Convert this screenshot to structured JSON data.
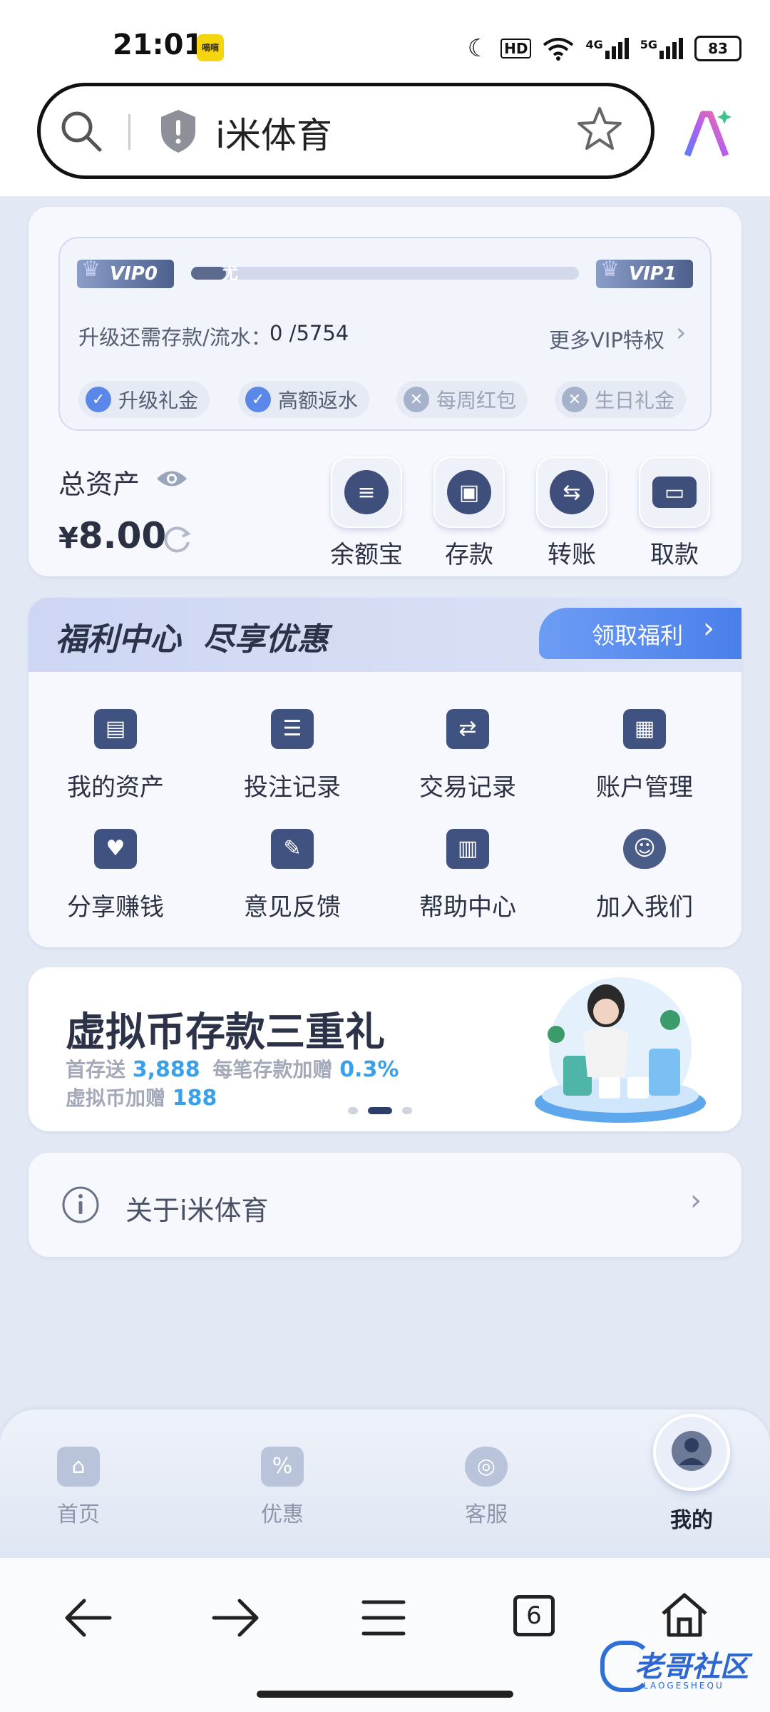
{
  "status_bar": {
    "time": "21:01",
    "app_badge": "嘀嘀",
    "network_hd": "HD",
    "net_4g": "4G",
    "net_5g": "5G",
    "battery": "83"
  },
  "browser": {
    "site_title": "i米体育"
  },
  "vip": {
    "current_level": "VIP0",
    "next_level": "VIP1",
    "progress_fraction": 0.05,
    "progress_marker": "尤",
    "upgrade_label": "升级还需存款/流水：",
    "upgrade_value": "0 /5754",
    "more_link": "更多VIP特权",
    "perks": [
      {
        "label": "升级礼金",
        "enabled": true
      },
      {
        "label": "高额返水",
        "enabled": true
      },
      {
        "label": "每周红包",
        "enabled": false
      },
      {
        "label": "生日礼金",
        "enabled": false
      }
    ]
  },
  "assets": {
    "label": "总资产",
    "currency": "¥",
    "amount": "8.00"
  },
  "quick_actions": [
    {
      "label": "余额宝",
      "icon": "coins-icon"
    },
    {
      "label": "存款",
      "icon": "deposit-icon"
    },
    {
      "label": "转账",
      "icon": "transfer-icon"
    },
    {
      "label": "取款",
      "icon": "card-icon"
    }
  ],
  "welfare": {
    "title": "福利中心  尽享优惠",
    "claim_button": "领取福利"
  },
  "menu": [
    {
      "label": "我的资产",
      "icon": "wallet-icon"
    },
    {
      "label": "投注记录",
      "icon": "bet-record-icon"
    },
    {
      "label": "交易记录",
      "icon": "transaction-icon"
    },
    {
      "label": "账户管理",
      "icon": "account-folder-icon"
    },
    {
      "label": "分享赚钱",
      "icon": "heart-hand-icon"
    },
    {
      "label": "意见反馈",
      "icon": "feedback-icon"
    },
    {
      "label": "帮助中心",
      "icon": "help-book-icon"
    },
    {
      "label": "加入我们",
      "icon": "people-icon"
    }
  ],
  "banner": {
    "title": "虚拟币存款三重礼",
    "line1_a": "首存送",
    "line1_b": "3,888",
    "line1_c": "每笔存款加赠",
    "line1_d": "0.3%",
    "line2_a": "虚拟币加赠",
    "line2_b": "188",
    "slides": 3,
    "active_slide": 2
  },
  "about": {
    "label": "关于i米体育"
  },
  "tab_bar": [
    {
      "label": "首页",
      "icon": "home-icon",
      "active": false
    },
    {
      "label": "优惠",
      "icon": "discount-icon",
      "active": false
    },
    {
      "label": "客服",
      "icon": "headset-icon",
      "active": false
    },
    {
      "label": "我的",
      "icon": "user-icon",
      "active": true
    }
  ],
  "browser_nav": {
    "tabs_count": "6"
  },
  "watermark": {
    "text": "老哥社区",
    "subtext": "LAOGESHEQU"
  },
  "colors": {
    "accent": "#3f5280",
    "perk_on": "#5a88e8",
    "welfare_blue": "#5b8cf0",
    "highlight_blue": "#3aa0e8"
  }
}
